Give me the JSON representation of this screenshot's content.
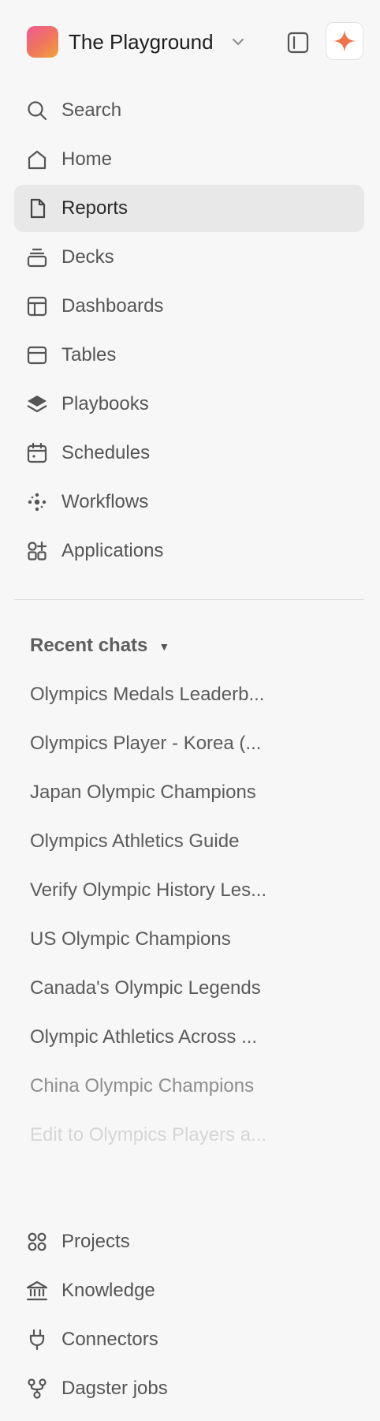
{
  "workspace": {
    "name": "The Playground"
  },
  "nav": [
    {
      "label": "Search",
      "icon": "search-icon"
    },
    {
      "label": "Home",
      "icon": "home-icon"
    },
    {
      "label": "Reports",
      "icon": "document-icon",
      "active": true
    },
    {
      "label": "Decks",
      "icon": "stack-icon"
    },
    {
      "label": "Dashboards",
      "icon": "dashboard-icon"
    },
    {
      "label": "Tables",
      "icon": "table-icon"
    },
    {
      "label": "Playbooks",
      "icon": "layers-icon"
    },
    {
      "label": "Schedules",
      "icon": "calendar-icon"
    },
    {
      "label": "Workflows",
      "icon": "workflow-icon"
    },
    {
      "label": "Applications",
      "icon": "apps-add-icon"
    }
  ],
  "recent_chats": {
    "title": "Recent chats",
    "items": [
      "Olympics Medals Leaderb...",
      "Olympics Player - Korea (...",
      "Japan Olympic Champions",
      "Olympics Athletics Guide",
      "Verify Olympic History Les...",
      "US Olympic Champions",
      "Canada's Olympic Legends",
      "Olympic Athletics Across ...",
      "China Olympic Champions",
      "Edit to Olympics Players a..."
    ]
  },
  "bottom_nav": [
    {
      "label": "Projects",
      "icon": "projects-icon"
    },
    {
      "label": "Knowledge",
      "icon": "bank-icon"
    },
    {
      "label": "Connectors",
      "icon": "plug-icon"
    },
    {
      "label": "Dagster jobs",
      "icon": "pipeline-icon"
    }
  ],
  "colors": {
    "background": "#f7f7f7",
    "active_item": "#e8e8e8",
    "accent": "#f0734a",
    "text": "#555555"
  }
}
